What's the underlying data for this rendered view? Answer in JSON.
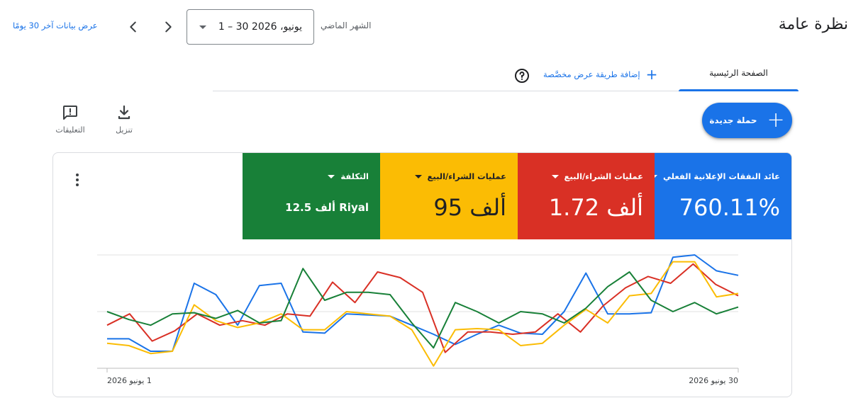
{
  "header": {
    "title": "نظرة عامة",
    "date_range_label": "الشهر الماضي",
    "date_range_value": "1 – 30 يونيو، 2026",
    "view_last_30_link": "عرض بيانات آخر 30 يومًا"
  },
  "tabs": {
    "home": "الصفحة الرئيسية",
    "add_custom_view": "إضافة طريقة عرض مخصَّصة"
  },
  "toolbar": {
    "new_campaign": "حملة جديدة",
    "download": "تنزيل",
    "feedback": "التعليقات"
  },
  "metrics": [
    {
      "label": "عائد النفقات الإعلانية الفعلي",
      "value": "760.11%",
      "color": "#1a73e8"
    },
    {
      "label": "عمليات الشراء/البيع",
      "value": "1.72 ألف",
      "color": "#d93025"
    },
    {
      "label": "عمليات الشراء/البيع",
      "value": "95 ألف",
      "color": "#fbbc04"
    },
    {
      "label": "التكلفة",
      "value": "12.5 ألف Riyal",
      "color": "#188038"
    }
  ],
  "chart_data": {
    "type": "line",
    "x_start_label": "1 يونيو 2026",
    "x_end_label": "30 يونيو 2026",
    "grid": true,
    "ylim": [
      0,
      100
    ],
    "series": [
      {
        "color": "#1a73e8",
        "values": [
          26,
          26,
          15,
          15,
          75,
          65,
          38,
          73,
          75,
          32,
          31,
          48,
          47,
          46,
          38,
          30,
          21,
          30,
          38,
          31,
          30,
          50,
          84,
          48,
          48,
          49,
          98,
          100,
          86,
          82
        ]
      },
      {
        "color": "#d93025",
        "values": [
          38,
          48,
          24,
          33,
          48,
          38,
          42,
          38,
          48,
          46,
          76,
          58,
          85,
          80,
          67,
          14,
          32,
          32,
          30,
          32,
          48,
          32,
          55,
          71,
          81,
          75,
          92,
          74,
          64
        ]
      },
      {
        "color": "#fbbc04",
        "values": [
          22,
          20,
          13,
          15,
          56,
          42,
          36,
          40,
          48,
          34,
          34,
          50,
          48,
          46,
          34,
          2,
          34,
          35,
          34,
          20,
          22,
          38,
          52,
          40,
          64,
          66,
          94,
          94,
          63,
          66
        ]
      },
      {
        "color": "#188038",
        "values": [
          50,
          43,
          38,
          48,
          49,
          44,
          51,
          40,
          42,
          88,
          60,
          67,
          67,
          65,
          40,
          18,
          58,
          50,
          40,
          50,
          48,
          40,
          53,
          72,
          85,
          60,
          50,
          58,
          48,
          54
        ]
      }
    ]
  }
}
